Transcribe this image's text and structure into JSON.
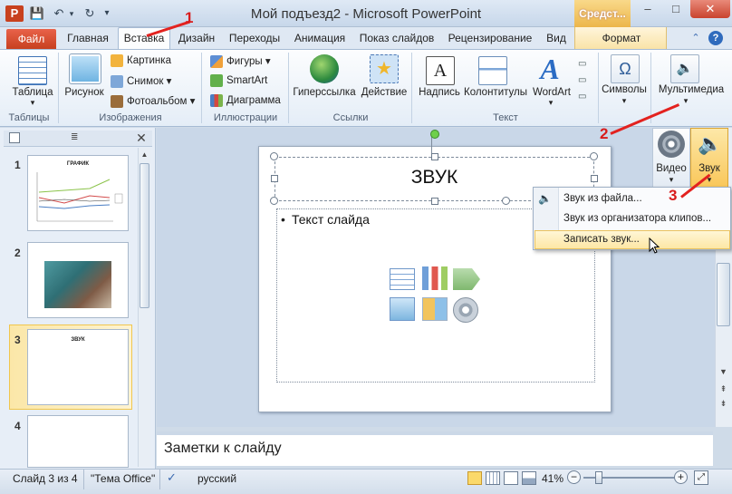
{
  "window": {
    "title": "Мой подъезд2 - Microsoft PowerPoint",
    "app_icon": "P",
    "context_tools": "Средст...",
    "controls": {
      "minimize": "–",
      "maximize": "□",
      "close": "✕"
    }
  },
  "quick_access": {
    "save": "💾",
    "undo": "↶",
    "redo": "↻",
    "customize": "▾"
  },
  "tabs": {
    "file": "Файл",
    "items": [
      "Главная",
      "Вставка",
      "Дизайн",
      "Переходы",
      "Анимация",
      "Показ слайдов",
      "Рецензирование",
      "Вид"
    ],
    "context": "Формат",
    "help": "?",
    "minimize_ribbon": "⌃"
  },
  "ribbon": {
    "tables": {
      "button": "Таблица",
      "group": "Таблицы"
    },
    "images": {
      "picture": "Рисунок",
      "clipart": "Картинка",
      "screenshot": "Снимок",
      "photoalbum": "Фотоальбом",
      "group": "Изображения"
    },
    "illustrations": {
      "shapes": "Фигуры",
      "smartart": "SmartArt",
      "chart": "Диаграмма",
      "group": "Иллюстрации"
    },
    "links": {
      "hyperlink": "Гиперссылка",
      "action": "Действие",
      "group": "Ссылки"
    },
    "text": {
      "textbox": "Надпись",
      "headerfooter": "Колонтитулы",
      "wordart": "WordArt",
      "group": "Текст"
    },
    "symbols": "Символы",
    "multimedia": "Мультимедиа",
    "symbols_glyph": "Ω",
    "video": "Видео",
    "sound": "Звук"
  },
  "sound_menu": {
    "items": [
      "Звук из файла...",
      "Звук из организатора клипов...",
      "Записать звук..."
    ]
  },
  "slides": [
    {
      "num": "1",
      "title": "ГРАФИК"
    },
    {
      "num": "2"
    },
    {
      "num": "3",
      "title": "ЗВУК"
    },
    {
      "num": "4"
    }
  ],
  "editor": {
    "slide_title": "ЗВУК",
    "bullet": "•",
    "bullet_text": "Текст слайда",
    "notes": "Заметки к слайду"
  },
  "annotations": {
    "step1": "1",
    "step2": "2",
    "step3": "3"
  },
  "status": {
    "slide_info": "Слайд 3 из 4",
    "theme": "\"Тема Office\"",
    "language": "русский",
    "zoom": "41%",
    "zoom_minus": "−",
    "zoom_plus": "+"
  },
  "colors": {
    "file_tab": "#c7401f",
    "annotation": "#e3221f",
    "selection": "#fde7a5"
  }
}
